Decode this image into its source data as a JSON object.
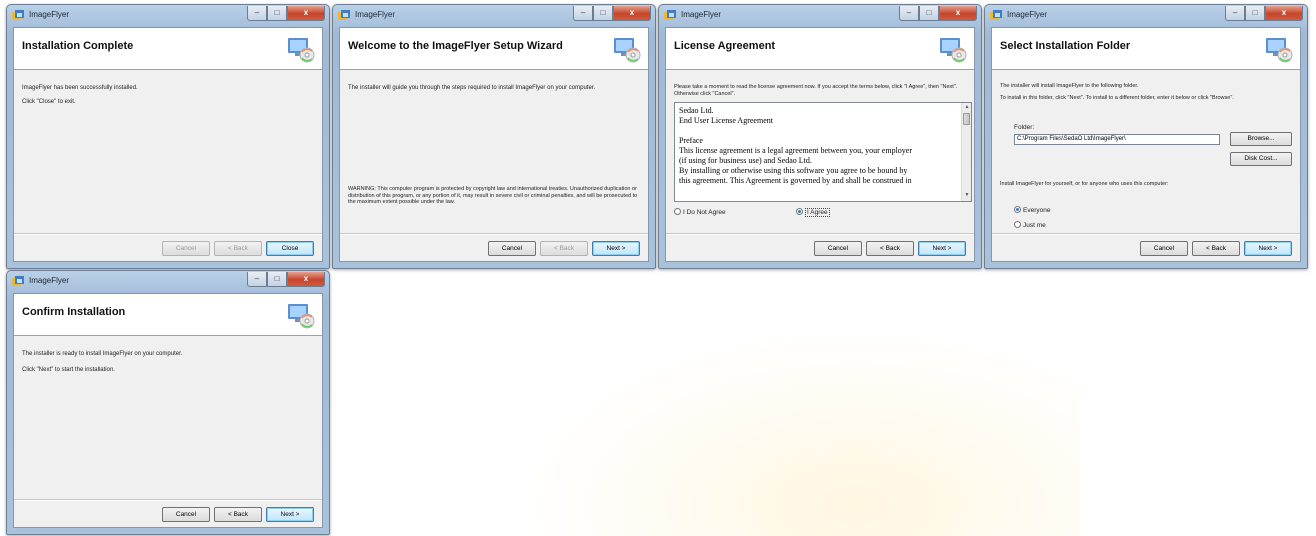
{
  "app_title": "ImageFlyer",
  "colors": {
    "accent_default_button": "#3c7fb1",
    "titlebar": "#b9d0e8",
    "close_button": "#c7452c"
  },
  "windows": {
    "complete": {
      "heading": "Installation Complete",
      "line1": "ImageFlyer has been successfully installed.",
      "line2": "Click \"Close\" to exit.",
      "btn_cancel": "Cancel",
      "btn_back": "< Back",
      "btn_close": "Close"
    },
    "welcome": {
      "heading": "Welcome to the ImageFlyer Setup Wizard",
      "line1": "The installer will guide you through the steps required to install ImageFlyer on your computer.",
      "warning": "WARNING: This computer program is protected by copyright law and international treaties. Unauthorized duplication or distribution of this program, or any portion of it, may result in severe civil or criminal penalties, and will be prosecuted to the maximum extent possible under the law.",
      "btn_cancel": "Cancel",
      "btn_back": "< Back",
      "btn_next": "Next >"
    },
    "license": {
      "heading": "License Agreement",
      "instructions": "Please take a moment to read the license agreement now. If you accept the terms below, click \"I Agree\", then \"Next\". Otherwise click \"Cancel\".",
      "text_lines": [
        "Sedao Ltd.",
        "End User License Agreement",
        "",
        "Preface",
        "This license agreement is a legal agreement between you, your employer",
        "(if using for business use) and Sedao Ltd.",
        "By installing or otherwise using this software you agree to be bound by",
        "this agreement. This Agreement is governed by and shall be construed in"
      ],
      "radio_disagree": "I Do Not Agree",
      "radio_agree": "I Agree",
      "btn_cancel": "Cancel",
      "btn_back": "< Back",
      "btn_next": "Next >"
    },
    "folder": {
      "heading": "Select Installation Folder",
      "line1": "The installer will install ImageFlyer to the following folder.",
      "line2": "To install in this folder, click \"Next\". To install to a different folder, enter it below or click \"Browse\".",
      "folder_label": "Folder:",
      "folder_value": "C:\\Program Files\\SedaO Ltd\\ImageFlyer\\",
      "btn_browse": "Browse...",
      "btn_disk_cost": "Disk Cost...",
      "users_prompt": "Install ImageFlyer for yourself, or for anyone who uses this computer:",
      "radio_everyone": "Everyone",
      "radio_just_me": "Just me",
      "btn_cancel": "Cancel",
      "btn_back": "< Back",
      "btn_next": "Next >"
    },
    "confirm": {
      "heading": "Confirm Installation",
      "line1": "The installer is ready to install ImageFlyer on your computer.",
      "line2": "Click \"Next\" to start the installation.",
      "btn_cancel": "Cancel",
      "btn_back": "< Back",
      "btn_next": "Next >"
    }
  }
}
